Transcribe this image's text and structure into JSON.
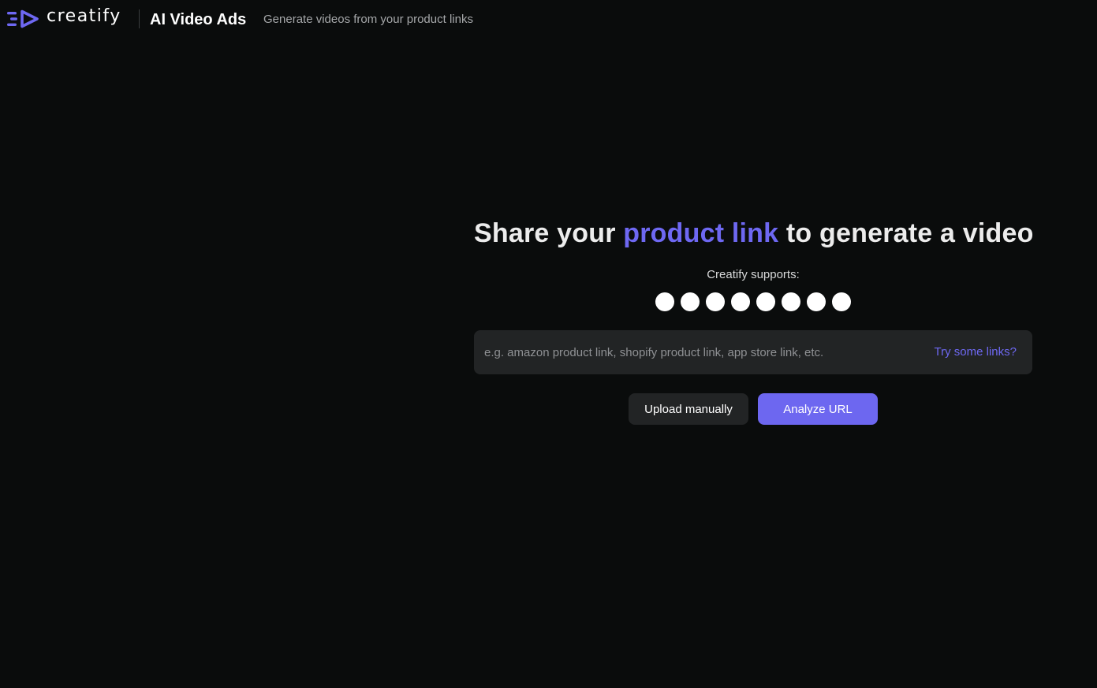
{
  "header": {
    "brand_name": "creatify",
    "app_title": "AI Video Ads",
    "app_subtitle": "Generate videos from your product links"
  },
  "hero": {
    "headline_before": "Share your ",
    "headline_accent": "product link",
    "headline_after": " to generate a video",
    "supports_label": "Creatify supports:",
    "platform_icons": [
      "platform-icon",
      "platform-icon",
      "platform-icon",
      "platform-icon",
      "platform-icon",
      "platform-icon",
      "platform-icon",
      "platform-icon"
    ]
  },
  "url_input": {
    "value": "",
    "placeholder": "e.g. amazon product link, shopify product link, app store link, etc.",
    "try_links_label": "Try some links?"
  },
  "actions": {
    "upload_label": "Upload manually",
    "analyze_label": "Analyze URL"
  },
  "colors": {
    "background": "#0a0c0c",
    "accent": "#6e68f2",
    "surface": "#222425"
  }
}
